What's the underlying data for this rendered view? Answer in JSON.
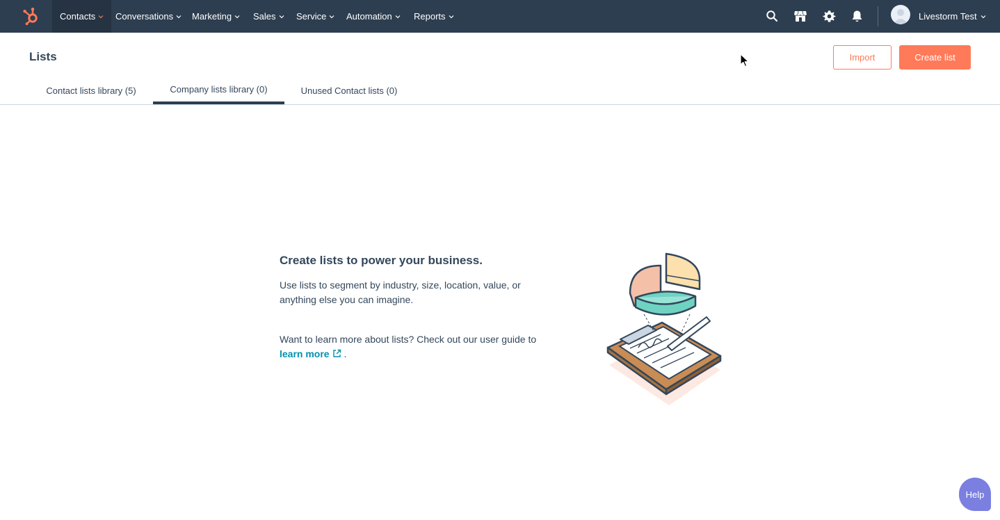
{
  "nav": {
    "items": [
      {
        "label": "Contacts",
        "active": true
      },
      {
        "label": "Conversations"
      },
      {
        "label": "Marketing"
      },
      {
        "label": "Sales"
      },
      {
        "label": "Service"
      },
      {
        "label": "Automation"
      },
      {
        "label": "Reports"
      }
    ],
    "account_label": "Livestorm Test",
    "icons": [
      "search-icon",
      "marketplace-icon",
      "settings-gear-icon",
      "notifications-bell-icon"
    ]
  },
  "header": {
    "title": "Lists",
    "import_label": "Import",
    "create_label": "Create list"
  },
  "tabs": [
    {
      "label": "Contact lists library (5)"
    },
    {
      "label": "Company lists library (0)",
      "active": true
    },
    {
      "label": "Unused Contact lists (0)"
    }
  ],
  "empty_state": {
    "title": "Create lists to power your business.",
    "description": "Use lists to segment by industry, size, location, value, or anything else you can imagine.",
    "learn_prefix": "Want to learn more about lists? Check out our user guide to",
    "learn_link": "learn more",
    "learn_suffix": "."
  },
  "help_label": "Help",
  "colors": {
    "nav_bg": "#2d3e50",
    "accent": "#ff7a59",
    "link": "#0091ae",
    "help": "#7b7fe0"
  }
}
